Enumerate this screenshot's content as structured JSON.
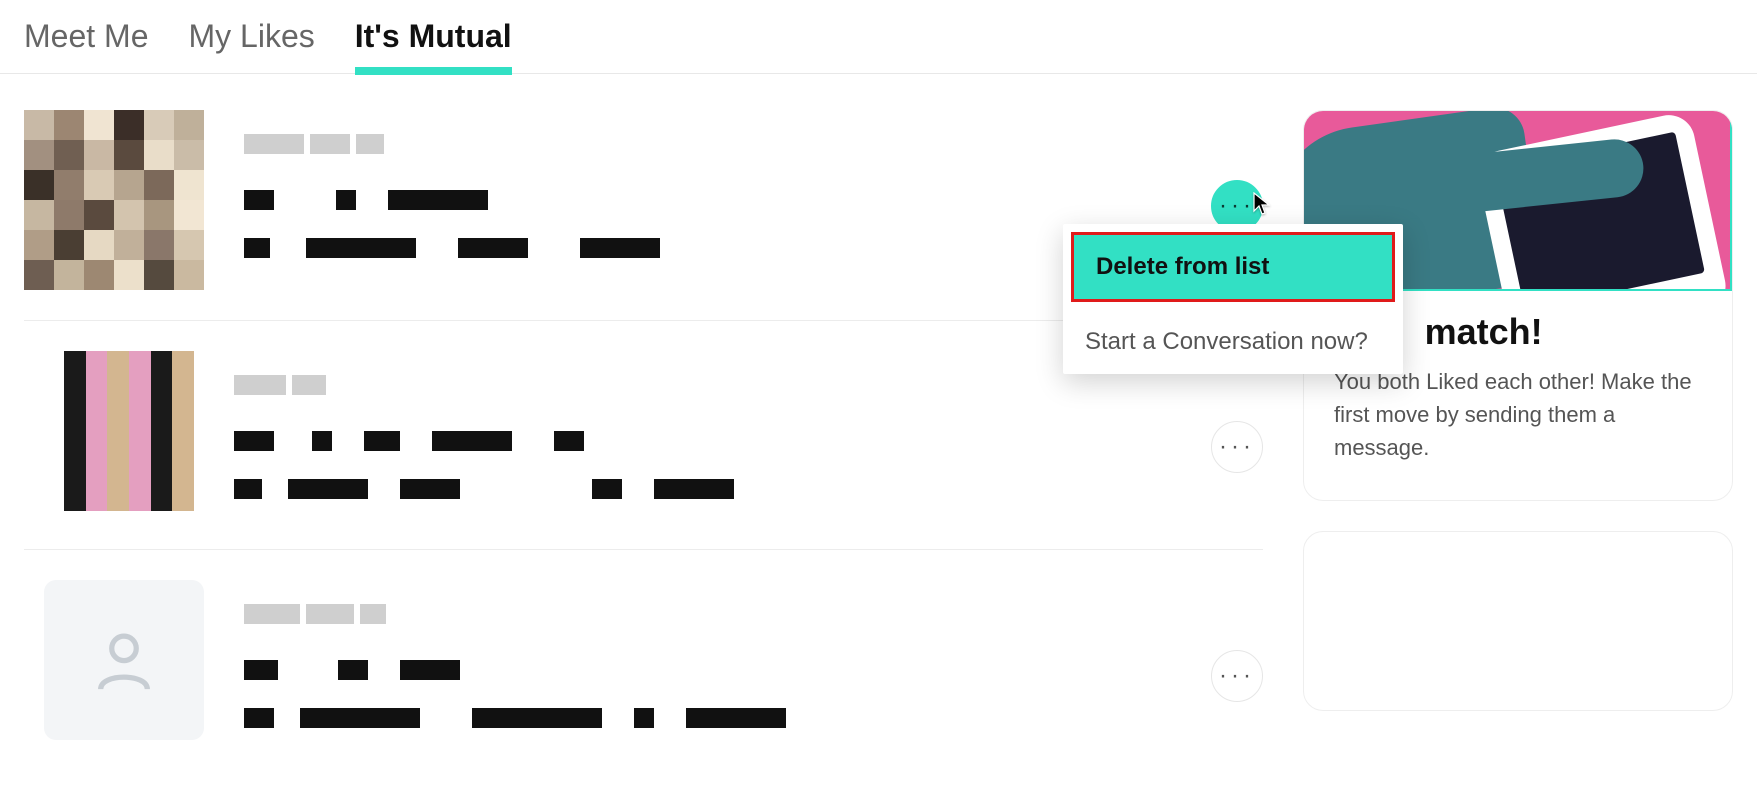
{
  "tabs": [
    {
      "label": "Meet Me",
      "active": false
    },
    {
      "label": "My Likes",
      "active": false
    },
    {
      "label": "It's Mutual",
      "active": true
    }
  ],
  "dropdown": {
    "delete_label": "Delete from list",
    "start_label": "Start a Conversation now?"
  },
  "match_card": {
    "title_fragment": "match!",
    "description": "You both Liked each other! Make the first move by sending them a message."
  }
}
